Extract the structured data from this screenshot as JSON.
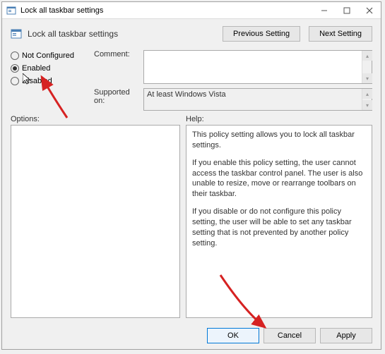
{
  "window": {
    "title": "Lock all taskbar settings",
    "header_title": "Lock all taskbar settings"
  },
  "nav": {
    "previous": "Previous Setting",
    "next": "Next Setting"
  },
  "radios": {
    "not_configured": "Not Configured",
    "enabled": "Enabled",
    "disabled": "Disabled",
    "selected": "enabled"
  },
  "labels": {
    "comment": "Comment:",
    "supported_on": "Supported on:",
    "options": "Options:",
    "help": "Help:"
  },
  "supported_text": "At least Windows Vista",
  "comment_text": "",
  "help_paragraphs": [
    "This policy setting allows you to lock all taskbar settings.",
    "If you enable this policy setting, the user cannot access the taskbar control panel. The user is also unable to resize, move or rearrange toolbars on their taskbar.",
    "If you disable or do not configure this policy setting, the user will be able to set any taskbar setting that is not prevented by another policy setting."
  ],
  "buttons": {
    "ok": "OK",
    "cancel": "Cancel",
    "apply": "Apply"
  }
}
